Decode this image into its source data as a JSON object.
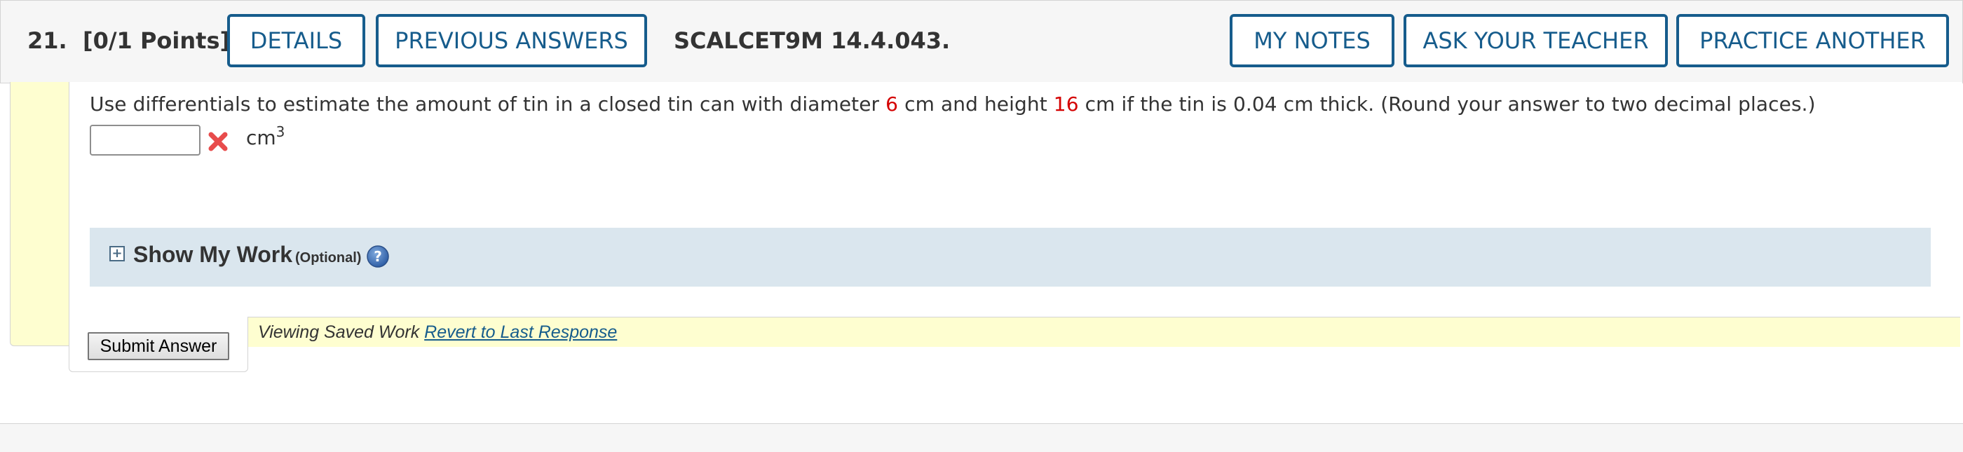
{
  "header": {
    "question_number": "21.",
    "points": "[0/1 Points]",
    "details_label": "DETAILS",
    "previous_answers_label": "PREVIOUS ANSWERS",
    "problem_code": "SCALCET9M 14.4.043.",
    "my_notes_label": "MY NOTES",
    "ask_teacher_label": "ASK YOUR TEACHER",
    "practice_another_label": "PRACTICE ANOTHER"
  },
  "question": {
    "text_before_diameter": "Use differentials to estimate the amount of tin in a closed tin can with diameter ",
    "diameter": "6",
    "text_between": " cm and height ",
    "height": "16",
    "text_after_height": " cm if the tin is 0.04 cm thick. (Round your answer to two decimal places.)",
    "answer_value": "",
    "answer_status": "incorrect",
    "unit": "cm",
    "unit_exponent": "3"
  },
  "show_my_work": {
    "title": "Show My Work",
    "optional_label": "(Optional)",
    "help_icon": "question-circle-icon"
  },
  "submit": {
    "button_label": "Submit Answer",
    "saved_text": "Viewing Saved Work",
    "revert_link": "Revert to Last Response"
  },
  "colors": {
    "accent": "#165c8c",
    "highlight_value": "#d40000",
    "incorrect_mark": "#e84c4c",
    "show_my_work_bg": "#dae6ee",
    "frame_yellow": "#fefed0"
  }
}
